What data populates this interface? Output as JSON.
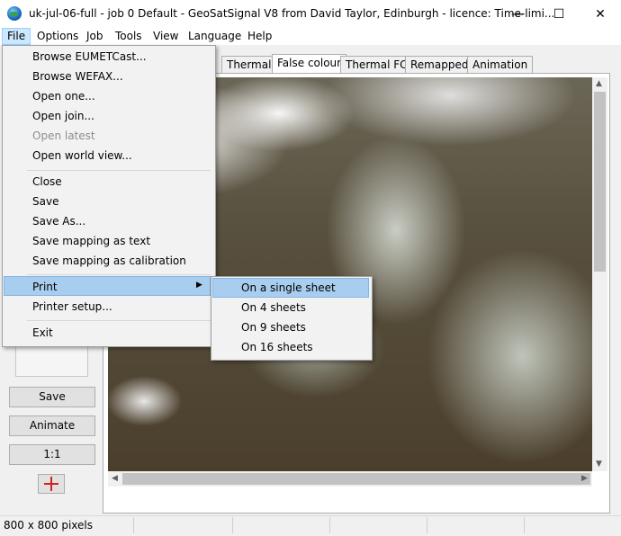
{
  "window": {
    "title": "uk-jul-06-full - job 0 Default - GeoSatSignal V8 from David Taylor, Edinburgh - licence: Time-limi...",
    "minimize_glyph": "—",
    "maximize_glyph": "☐",
    "close_glyph": "✕"
  },
  "menubar": [
    "File",
    "Options",
    "Job",
    "Tools",
    "View",
    "Language",
    "Help"
  ],
  "tabs": [
    "Thermal",
    "False colour",
    "Thermal FC",
    "Remapped",
    "Animation"
  ],
  "file_menu": {
    "items": [
      {
        "label": "Browse EUMETCast...",
        "enabled": true
      },
      {
        "label": "Browse WEFAX...",
        "enabled": true
      },
      {
        "label": "Open one...",
        "enabled": true
      },
      {
        "label": "Open join...",
        "enabled": true
      },
      {
        "label": "Open latest",
        "enabled": false
      },
      {
        "label": "Open world view...",
        "enabled": true
      },
      {
        "label": "Close",
        "enabled": true
      },
      {
        "label": "Save",
        "enabled": true
      },
      {
        "label": "Save As...",
        "enabled": true
      },
      {
        "label": "Save mapping as text",
        "enabled": true
      },
      {
        "label": "Save mapping as calibration",
        "enabled": true
      },
      {
        "label": "Print",
        "enabled": true
      },
      {
        "label": "Printer setup...",
        "enabled": true
      },
      {
        "label": "Exit",
        "enabled": true
      }
    ],
    "submenu_arrow": "▶"
  },
  "print_submenu": [
    "On a single sheet",
    "On 4 sheets",
    "On 9 sheets",
    "On 16 sheets"
  ],
  "left_panel": {
    "save_button": "Save",
    "animate_button": "Animate",
    "zoom_button": "1:1"
  },
  "scroll_arrows": {
    "up": "▲",
    "down": "▼",
    "left": "◀",
    "right": "▶"
  },
  "status": {
    "pixels": "800 x 800 pixels"
  },
  "colors": {
    "menu_highlight": "#a8cdee",
    "file_menu_active": "#cce8ff",
    "crosshair": "#d32020"
  }
}
